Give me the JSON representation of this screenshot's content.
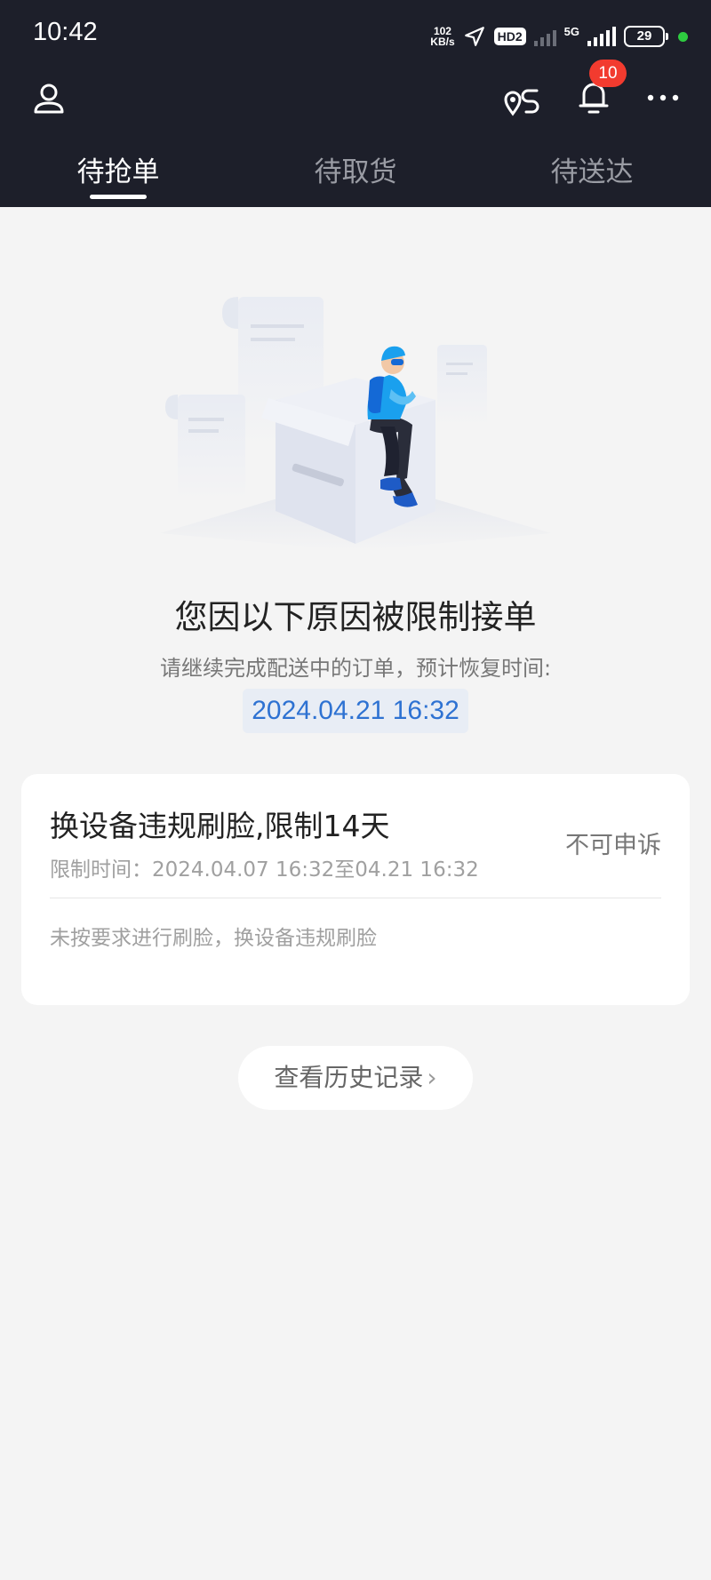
{
  "status_bar": {
    "time": "10:42",
    "net_speed_value": "102",
    "net_speed_unit": "KB/s",
    "hd": "HD2",
    "network": "5G",
    "battery": "29"
  },
  "header": {
    "notification_count": "10"
  },
  "tabs": [
    {
      "label": "待抢单",
      "active": true
    },
    {
      "label": "待取货",
      "active": false
    },
    {
      "label": "待送达",
      "active": false
    }
  ],
  "main": {
    "title": "您因以下原因被限制接单",
    "subtitle": "请继续完成配送中的订单，预计恢复时间:",
    "restore_time": "2024.04.21 16:32"
  },
  "restriction_card": {
    "title": "换设备违规刷脸,限制14天",
    "time_range": "限制时间：2024.04.07 16:32至04.21 16:32",
    "appeal_status": "不可申诉",
    "reason": "未按要求进行刷脸，换设备违规刷脸"
  },
  "history_button": {
    "label": "查看历史记录",
    "chevron": "›"
  },
  "colors": {
    "header_bg": "#1d1f2a",
    "accent_blue": "#2e72d2",
    "badge_red": "#f23b2f",
    "page_bg": "#f4f4f4"
  }
}
